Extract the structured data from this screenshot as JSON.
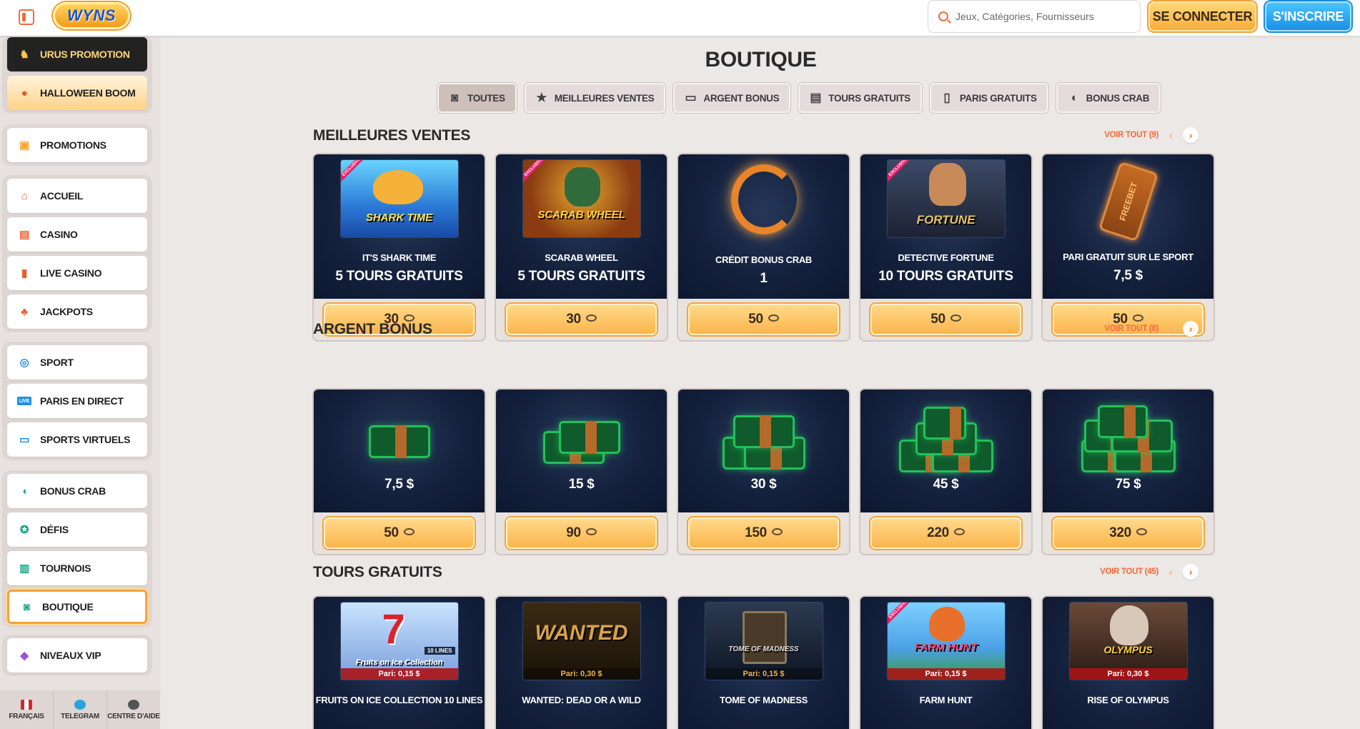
{
  "header": {
    "logo_text": "WYNS",
    "search_placeholder": "Jeux, Catégories, Fournisseurs",
    "login_label": "SE CONNECTER",
    "signup_label": "S'INSCRIRE"
  },
  "sidebar": {
    "groups": [
      {
        "items": [
          {
            "label": "URUS PROMOTION",
            "icon": "bull-icon"
          },
          {
            "label": "HALLOWEEN BOOM",
            "icon": "pumpkin-icon"
          }
        ]
      },
      {
        "items": [
          {
            "label": "PROMOTIONS",
            "icon": "gift-icon"
          }
        ]
      },
      {
        "items": [
          {
            "label": "ACCUEIL",
            "icon": "home-icon"
          },
          {
            "label": "CASINO",
            "icon": "slot-machine-icon"
          },
          {
            "label": "LIVE CASINO",
            "icon": "cards-icon"
          },
          {
            "label": "JACKPOTS",
            "icon": "clover-icon"
          }
        ]
      },
      {
        "items": [
          {
            "label": "SPORT",
            "icon": "ball-icon"
          },
          {
            "label": "PARIS EN DIRECT",
            "icon": "live-icon"
          },
          {
            "label": "SPORTS VIRTUELS",
            "icon": "monitor-icon"
          }
        ]
      },
      {
        "items": [
          {
            "label": "BONUS CRAB",
            "icon": "crab-claw-icon"
          },
          {
            "label": "DÉFIS",
            "icon": "medal-icon"
          },
          {
            "label": "TOURNOIS",
            "icon": "podium-icon"
          },
          {
            "label": "BOUTIQUE",
            "icon": "basket-icon"
          }
        ]
      },
      {
        "items": [
          {
            "label": "NIVEAUX VIP",
            "icon": "diamond-icon"
          }
        ]
      }
    ],
    "footer": [
      {
        "label": "FRANÇAIS",
        "icon": "canada-flag-icon"
      },
      {
        "label": "TELEGRAM",
        "icon": "telegram-icon"
      },
      {
        "label": "CENTRE D'AIDE",
        "icon": "help-icon"
      }
    ]
  },
  "page": {
    "title": "BOUTIQUE",
    "tabs": [
      {
        "label": "TOUTES",
        "icon": "basket-icon"
      },
      {
        "label": "MEILLEURES VENTES",
        "icon": "star-icon"
      },
      {
        "label": "ARGENT BONUS",
        "icon": "money-icon"
      },
      {
        "label": "TOURS GRATUITS",
        "icon": "slot-icon"
      },
      {
        "label": "PARIS GRATUITS",
        "icon": "ticket-icon"
      },
      {
        "label": "BONUS CRAB",
        "icon": "crab-claw-icon"
      }
    ]
  },
  "sections": [
    {
      "title": "MEILLEURES VENTES",
      "see_all": "VOIR TOUT (9)",
      "cards": [
        {
          "name": "IT'S SHARK TIME",
          "value": "5 TOURS GRATUITS",
          "price": "30",
          "exclusive": "EXCLUSIVE"
        },
        {
          "name": "SCARAB WHEEL",
          "value": "5 TOURS GRATUITS",
          "price": "30",
          "exclusive": "EXCLUSIVE"
        },
        {
          "name": "CRÉDIT BONUS CRAB",
          "value": "1",
          "price": "50"
        },
        {
          "name": "DETECTIVE FORTUNE",
          "value": "10 TOURS GRATUITS",
          "price": "50",
          "exclusive": "EXCLUSIVE"
        },
        {
          "name": "PARI GRATUIT SUR LE SPORT",
          "value": "7,5 $",
          "price": "50"
        }
      ]
    },
    {
      "title": "ARGENT BONUS",
      "see_all": "VOIR TOUT (8)",
      "cards": [
        {
          "value": "7,5 $",
          "price": "50"
        },
        {
          "value": "15 $",
          "price": "90"
        },
        {
          "value": "30 $",
          "price": "150"
        },
        {
          "value": "45 $",
          "price": "220"
        },
        {
          "value": "75 $",
          "price": "320"
        }
      ]
    },
    {
      "title": "TOURS GRATUITS",
      "see_all": "VOIR TOUT (45)",
      "cards": [
        {
          "name": "FRUITS ON ICE COLLECTION 10 LINES",
          "pari": "Pari: 0,15 $"
        },
        {
          "name": "WANTED: DEAD OR A WILD",
          "pari": "Pari: 0,30 $"
        },
        {
          "name": "TOME OF MADNESS",
          "pari": "Pari: 0,15 $"
        },
        {
          "name": "FARM HUNT",
          "pari": "Pari: 0,15 $",
          "exclusive": "EXCLUSIVE"
        },
        {
          "name": "RISE OF OLYMPUS",
          "pari": "Pari: 0,30 $"
        }
      ]
    }
  ],
  "game_logos": {
    "shark": "SHARK TIME",
    "scarab": "SCARAB WHEEL",
    "detective": "FORTUNE",
    "freebet": "FREEBET",
    "fruits": "Fruits on Ice Collection",
    "fruits_lines": "10 LINES",
    "wanted": "WANTED",
    "tome": "TOME OF MADNESS",
    "farm": "FARM HUNT",
    "olympus": "OLYMPUS"
  },
  "colors": {
    "accent": "#f26c3a",
    "gold": "#fbb54c",
    "blue": "#1b8fe6",
    "card_bg": "#14213c"
  }
}
